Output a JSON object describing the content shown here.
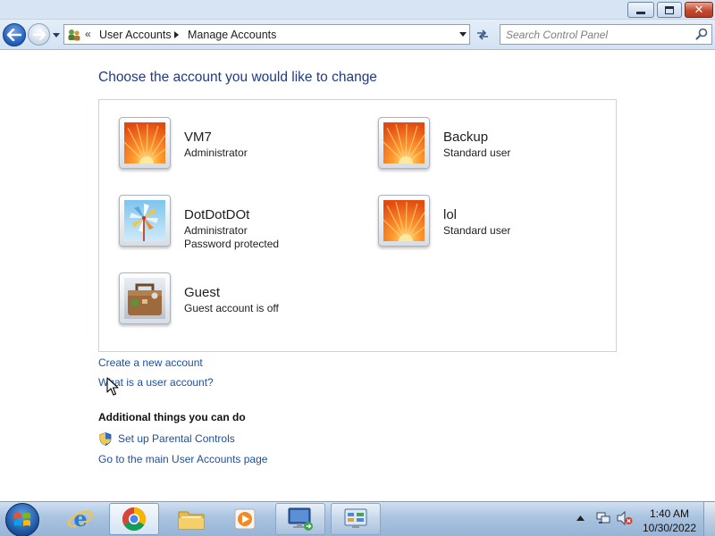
{
  "window": {
    "controls": {
      "minimize": "minimize",
      "maximize": "restore",
      "close": "close"
    }
  },
  "navbar": {
    "breadcrumb": [
      "User Accounts",
      "Manage Accounts"
    ],
    "overflow_chevron": "«",
    "search_placeholder": "Search Control Panel"
  },
  "main": {
    "heading": "Choose the account you would like to change",
    "accounts": [
      {
        "name": "VM7",
        "details": [
          "Administrator"
        ],
        "picture": "orange-flower"
      },
      {
        "name": "Backup",
        "details": [
          "Standard user"
        ],
        "picture": "orange-flower"
      },
      {
        "name": "DotDotDOt",
        "details": [
          "Administrator",
          "Password protected"
        ],
        "picture": "pinwheel"
      },
      {
        "name": "lol",
        "details": [
          "Standard user"
        ],
        "picture": "orange-flower"
      },
      {
        "name": "Guest",
        "details": [
          "Guest account is off"
        ],
        "picture": "suitcase"
      }
    ],
    "links": {
      "create": "Create a new account",
      "what": "What is a user account?"
    },
    "additional": {
      "title": "Additional things you can do",
      "parental": "Set up Parental Controls",
      "main_page": "Go to the main User Accounts page"
    }
  },
  "taskbar": {
    "apps": [
      "internet-explorer",
      "chrome",
      "file-explorer",
      "media-player",
      "remote-desktop",
      "control-panel"
    ],
    "clock": {
      "time": "1:40 AM",
      "date": "10/30/2022"
    }
  },
  "colors": {
    "heading": "#1e3a8a",
    "link": "#1e4f9c",
    "close_button": "#c24a2e"
  }
}
